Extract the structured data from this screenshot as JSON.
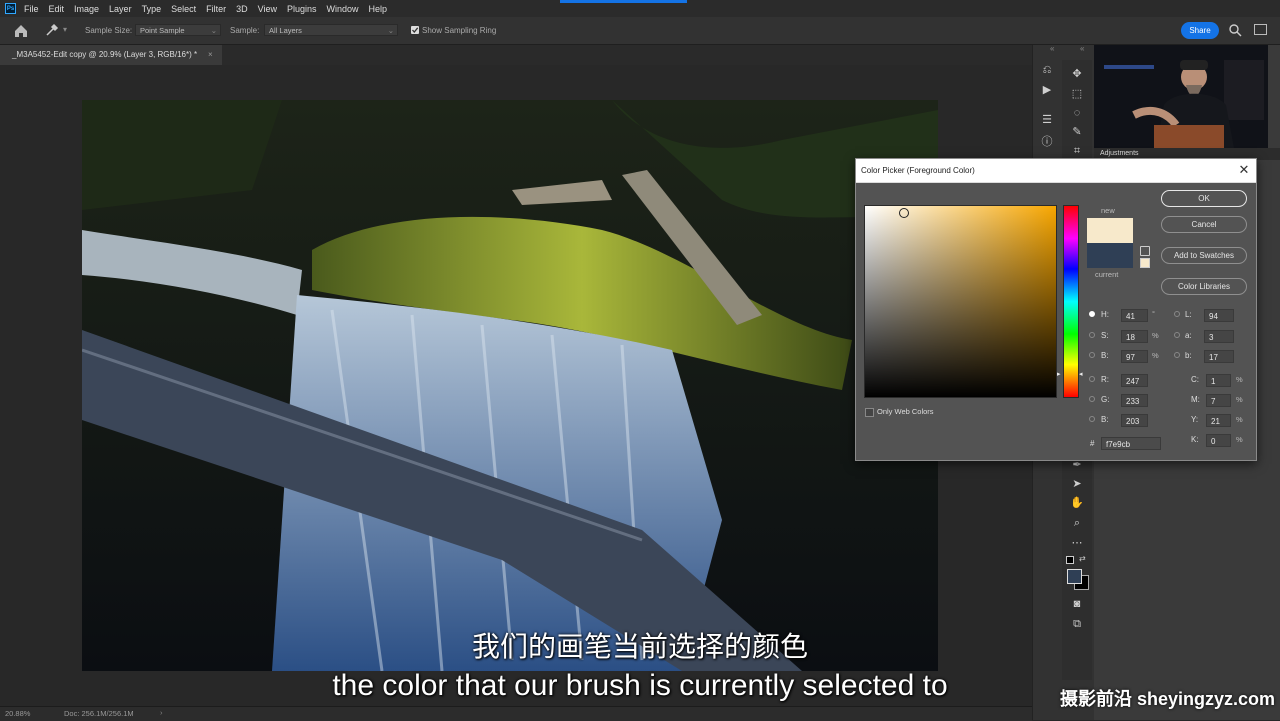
{
  "menu": {
    "app_icon": "Ps",
    "items": [
      "File",
      "Edit",
      "Image",
      "Layer",
      "Type",
      "Select",
      "Filter",
      "3D",
      "View",
      "Plugins",
      "Window",
      "Help"
    ]
  },
  "options_bar": {
    "sample_size_label": "Sample Size:",
    "sample_size_value": "Point Sample",
    "sample_label": "Sample:",
    "sample_value": "All Layers",
    "show_ring_label": "Show Sampling Ring",
    "share_label": "Share"
  },
  "document": {
    "tab_title": "_M3A5452-Edit copy @ 20.9% (Layer 3, RGB/16*) *",
    "tab_close": "×"
  },
  "status_bar": {
    "zoom": "20.88%",
    "doc_info": "Doc: 256.1M/256.1M"
  },
  "panels": {
    "adjustments_tab": "Adjustments"
  },
  "color_picker": {
    "title": "Color Picker (Foreground Color)",
    "close": "✕",
    "new_label": "new",
    "current_label": "current",
    "ok_label": "OK",
    "cancel_label": "Cancel",
    "add_swatches_label": "Add to Swatches",
    "color_libraries_label": "Color Libraries",
    "only_web_colors_label": "Only Web Colors",
    "hsb": {
      "h": "41",
      "h_unit": "°",
      "s": "18",
      "s_unit": "%",
      "b": "97",
      "b_unit": "%"
    },
    "rgb": {
      "r": "247",
      "g": "233",
      "b": "203"
    },
    "lab": {
      "l": "94",
      "a": "3",
      "b": "17"
    },
    "cmyk": {
      "c": "1",
      "m": "7",
      "y": "21",
      "k": "0",
      "unit": "%"
    },
    "hex_label": "#",
    "hex": "f7e9cb",
    "labels": {
      "h": "H:",
      "s": "S:",
      "b": "B:",
      "r": "R:",
      "g": "G:",
      "bb": "B:",
      "l": "L:",
      "a": "a:",
      "lb": "b:",
      "c": "C:",
      "m": "M:",
      "y": "Y:",
      "k": "K:"
    },
    "new_color": "#f7e9cb",
    "current_color": "#2f3f55"
  },
  "subtitles": {
    "chinese": "我们的画笔当前选择的颜色",
    "english": "the color that our brush is currently selected to"
  },
  "watermark": "摄影前沿 sheyingzyz.com",
  "colors": {
    "accent": "#1473e6"
  }
}
